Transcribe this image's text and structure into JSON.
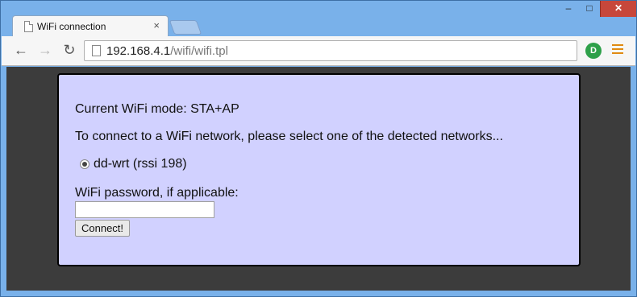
{
  "browser": {
    "tab_title": "WiFi connection",
    "tab_close": "×",
    "url_host": "192.168.4.1",
    "url_path": "/wifi/wifi.tpl",
    "window_controls": {
      "minimize": "–",
      "maximize": "□",
      "close": "✕"
    },
    "icons": {
      "back": "←",
      "forward": "→",
      "reload": "↻",
      "extension": "D"
    }
  },
  "page": {
    "mode_text": "Current WiFi mode: STA+AP",
    "instruction_text": "To connect to a WiFi network, please select one of the detected networks...",
    "networks": [
      {
        "label": "dd-wrt (rssi 198)",
        "selected": true
      }
    ],
    "password_label": "WiFi password, if applicable:",
    "password_value": "",
    "connect_label": "Connect!"
  },
  "colors": {
    "panel_background": "#d1d1ff",
    "page_background": "#3c3c3c",
    "window_frame": "#79b1ea",
    "close_button": "#c7473b"
  }
}
